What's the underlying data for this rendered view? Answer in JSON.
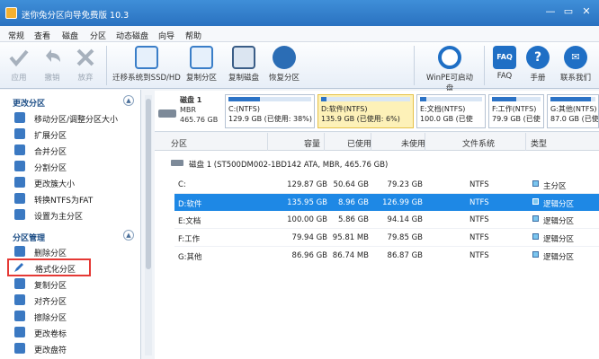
{
  "window": {
    "title": "迷你兔分区向导免费版 10.3"
  },
  "menu": [
    "常规",
    "查看",
    "磁盘",
    "分区",
    "动态磁盘",
    "向导",
    "帮助"
  ],
  "toolbar": {
    "apply": "应用",
    "undo": "撤销",
    "discard": "放弃",
    "migrate": "迁移系统到SSD/HD",
    "copy_partition": "复制分区",
    "copy_disk": "复制磁盘",
    "recover": "恢复分区",
    "winpe": "WinPE可启动盘",
    "faq": "FAQ",
    "manual": "手册",
    "contact": "联系我们",
    "faq_icon_text": "FAQ"
  },
  "sidebar": {
    "section1": "更改分区",
    "section1_items": [
      "移动分区/调整分区大小",
      "扩展分区",
      "合并分区",
      "分割分区",
      "更改簇大小",
      "转换NTFS为FAT",
      "设置为主分区"
    ],
    "section2": "分区管理",
    "section2_items": [
      "删除分区",
      "格式化分区",
      "复制分区",
      "对齐分区",
      "擦除分区",
      "更改卷标",
      "更改盘符"
    ]
  },
  "disk_strip": {
    "disk_name": "磁盘 1",
    "disk_type": "MBR",
    "disk_size": "465.76 GB",
    "partitions": [
      {
        "line1": "C:(NTFS)",
        "line2": "129.9 GB (已使用: 38%)",
        "used": 0.38
      },
      {
        "line1": "D:软件(NTFS)",
        "line2": "135.9 GB (已使用: 6%)",
        "used": 0.06
      },
      {
        "line1": "E:文档(NTFS)",
        "line2": "100.0 GB (已使",
        "used": 0.1
      },
      {
        "line1": "F:工作(NTFS)",
        "line2": "79.9 GB (已使",
        "used": 0.5
      },
      {
        "line1": "G:其他(NTFS)",
        "line2": "87.0 GB (已使",
        "used": 0.9
      }
    ]
  },
  "grid": {
    "headers": [
      "分区",
      "容量",
      "已使用",
      "未使用",
      "文件系统",
      "类型"
    ],
    "disk_row": "磁盘 1 (ST500DM002-1BD142 ATA, MBR, 465.76 GB)",
    "rows": [
      {
        "name": "C:",
        "cap": "129.87 GB",
        "used": "50.64 GB",
        "free": "79.23 GB",
        "fs": "NTFS",
        "type": "主分区"
      },
      {
        "name": "D:软件",
        "cap": "135.95 GB",
        "used": "8.96 GB",
        "free": "126.99 GB",
        "fs": "NTFS",
        "type": "逻辑分区"
      },
      {
        "name": "E:文档",
        "cap": "100.00 GB",
        "used": "5.86 GB",
        "free": "94.14 GB",
        "fs": "NTFS",
        "type": "逻辑分区"
      },
      {
        "name": "F:工作",
        "cap": "79.94 GB",
        "used": "95.81 MB",
        "free": "79.85 GB",
        "fs": "NTFS",
        "type": "逻辑分区"
      },
      {
        "name": "G:其他",
        "cap": "86.96 GB",
        "used": "86.74 MB",
        "free": "86.87 GB",
        "fs": "NTFS",
        "type": "逻辑分区"
      }
    ]
  },
  "colors": {
    "accent": "#1e88e5",
    "title_bar": "#2f7fcf",
    "highlight_border": "#e53935",
    "used_bar": "#2c73c6"
  }
}
